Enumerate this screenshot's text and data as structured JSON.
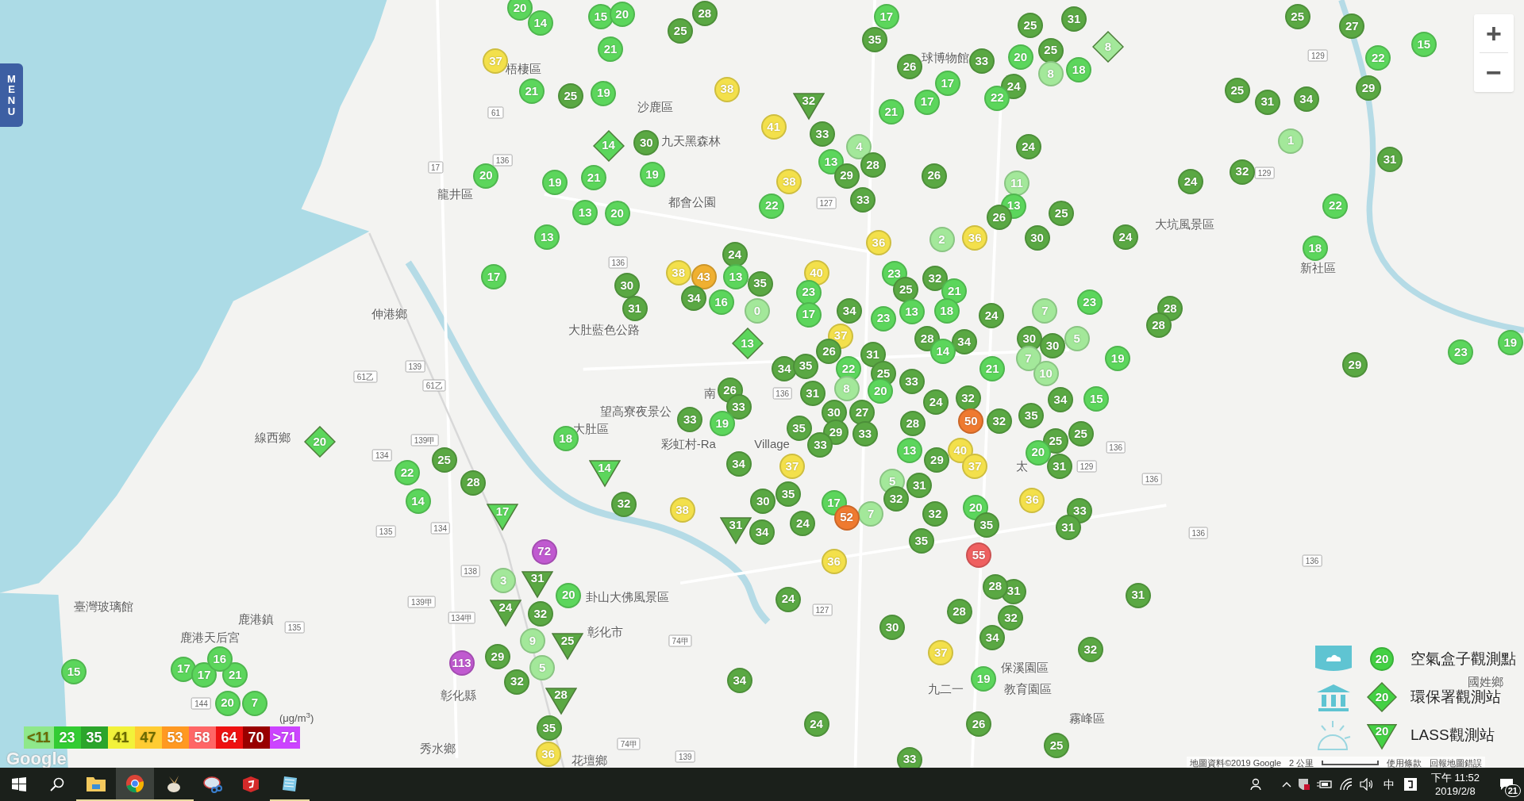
{
  "menu_button": "MENU",
  "zoom_controls": [
    "+",
    "−"
  ],
  "map_labels": [
    {
      "text": "梧棲區",
      "kind": "place"
    },
    {
      "text": "沙鹿區",
      "kind": "place"
    },
    {
      "text": "九天黑森林",
      "kind": "place"
    },
    {
      "text": "龍井區",
      "kind": "place"
    },
    {
      "text": "都會公園",
      "kind": "place"
    },
    {
      "text": "大肚藍色公路",
      "kind": "place"
    },
    {
      "text": "伸港鄉",
      "kind": "place"
    },
    {
      "text": "望高寮夜景公",
      "kind": "place"
    },
    {
      "text": "大肚區",
      "kind": "place"
    },
    {
      "text": "彩虹村-Ra",
      "kind": "place"
    },
    {
      "text": "Village",
      "kind": "place"
    },
    {
      "text": "南",
      "kind": "place"
    },
    {
      "text": "線西鄉",
      "kind": "place"
    },
    {
      "text": "鹿港鎮",
      "kind": "place"
    },
    {
      "text": "鹿港天后宮",
      "kind": "place"
    },
    {
      "text": "臺灣玻璃館",
      "kind": "place"
    },
    {
      "text": "卦山大佛風景區",
      "kind": "place"
    },
    {
      "text": "彰化市",
      "kind": "place"
    },
    {
      "text": "彰化縣",
      "kind": "place"
    },
    {
      "text": "秀水鄉",
      "kind": "place"
    },
    {
      "text": "花壇鄉",
      "kind": "place"
    },
    {
      "text": "大坑風景區",
      "kind": "place"
    },
    {
      "text": "新社區",
      "kind": "place"
    },
    {
      "text": "太",
      "kind": "place"
    },
    {
      "text": "國姓鄉",
      "kind": "place"
    },
    {
      "text": "霧峰區",
      "kind": "place"
    },
    {
      "text": "球博物館",
      "kind": "place"
    },
    {
      "text": "保溪園區",
      "kind": "place"
    },
    {
      "text": "九二一",
      "kind": "place"
    },
    {
      "text": "教育園區",
      "kind": "place"
    },
    {
      "text": "136",
      "kind": "road"
    },
    {
      "text": "17",
      "kind": "road"
    },
    {
      "text": "61",
      "kind": "road"
    },
    {
      "text": "136",
      "kind": "road"
    },
    {
      "text": "139",
      "kind": "road"
    },
    {
      "text": "61乙",
      "kind": "road"
    },
    {
      "text": "61乙",
      "kind": "road"
    },
    {
      "text": "139甲",
      "kind": "road"
    },
    {
      "text": "134",
      "kind": "road"
    },
    {
      "text": "134",
      "kind": "road"
    },
    {
      "text": "135",
      "kind": "road"
    },
    {
      "text": "138",
      "kind": "road"
    },
    {
      "text": "139甲",
      "kind": "road"
    },
    {
      "text": "134甲",
      "kind": "road"
    },
    {
      "text": "135",
      "kind": "road"
    },
    {
      "text": "144",
      "kind": "road"
    },
    {
      "text": "127",
      "kind": "road"
    },
    {
      "text": "127",
      "kind": "road"
    },
    {
      "text": "136",
      "kind": "road"
    },
    {
      "text": "129",
      "kind": "road"
    },
    {
      "text": "136",
      "kind": "road"
    },
    {
      "text": "136",
      "kind": "road"
    },
    {
      "text": "136",
      "kind": "road"
    },
    {
      "text": "129",
      "kind": "road"
    },
    {
      "text": "129",
      "kind": "road"
    },
    {
      "text": "74甲",
      "kind": "road"
    },
    {
      "text": "139",
      "kind": "road"
    },
    {
      "text": "74甲",
      "kind": "road"
    },
    {
      "text": "136",
      "kind": "road"
    }
  ],
  "markers": [
    {
      "value": "20",
      "kind": "box",
      "color": "#5cd65c"
    },
    {
      "value": "14",
      "kind": "box",
      "color": "#5cd65c"
    },
    {
      "value": "15",
      "kind": "box",
      "color": "#5cd65c"
    },
    {
      "value": "20",
      "kind": "box",
      "color": "#5cd65c"
    },
    {
      "value": "28",
      "kind": "box",
      "color": "#5aa843"
    },
    {
      "value": "25",
      "kind": "box",
      "color": "#5aa843"
    },
    {
      "value": "21",
      "kind": "box",
      "color": "#5cd65c"
    },
    {
      "value": "37",
      "kind": "box",
      "color": "#f3e04b"
    },
    {
      "value": "21",
      "kind": "box",
      "color": "#5cd65c"
    },
    {
      "value": "25",
      "kind": "box",
      "color": "#5aa843"
    },
    {
      "value": "19",
      "kind": "box",
      "color": "#5cd65c"
    },
    {
      "value": "38",
      "kind": "box",
      "color": "#f3e04b"
    },
    {
      "value": "32",
      "kind": "lass",
      "color": "#5aa843"
    },
    {
      "value": "41",
      "kind": "box",
      "color": "#f3e04b"
    },
    {
      "value": "33",
      "kind": "box",
      "color": "#5aa843"
    },
    {
      "value": "14",
      "kind": "epa",
      "color": "#5cd65c"
    },
    {
      "value": "30",
      "kind": "box",
      "color": "#5aa843"
    },
    {
      "value": "20",
      "kind": "box",
      "color": "#5cd65c"
    },
    {
      "value": "19",
      "kind": "box",
      "color": "#5cd65c"
    },
    {
      "value": "21",
      "kind": "box",
      "color": "#5cd65c"
    },
    {
      "value": "19",
      "kind": "box",
      "color": "#5cd65c"
    },
    {
      "value": "13",
      "kind": "box",
      "color": "#5cd65c"
    },
    {
      "value": "20",
      "kind": "box",
      "color": "#5cd65c"
    },
    {
      "value": "13",
      "kind": "box",
      "color": "#5cd65c"
    },
    {
      "value": "17",
      "kind": "box",
      "color": "#5cd65c"
    },
    {
      "value": "17",
      "kind": "box",
      "color": "#5cd65c"
    },
    {
      "value": "35",
      "kind": "box",
      "color": "#5aa843"
    },
    {
      "value": "26",
      "kind": "box",
      "color": "#5aa843"
    },
    {
      "value": "17",
      "kind": "box",
      "color": "#5cd65c"
    },
    {
      "value": "17",
      "kind": "box",
      "color": "#5cd65c"
    },
    {
      "value": "21",
      "kind": "box",
      "color": "#5cd65c"
    },
    {
      "value": "33",
      "kind": "box",
      "color": "#5aa843"
    },
    {
      "value": "20",
      "kind": "box",
      "color": "#5cd65c"
    },
    {
      "value": "25",
      "kind": "box",
      "color": "#5aa843"
    },
    {
      "value": "25",
      "kind": "box",
      "color": "#5aa843"
    },
    {
      "value": "31",
      "kind": "box",
      "color": "#5aa843"
    },
    {
      "value": "8",
      "kind": "epa",
      "color": "#a3e89a"
    },
    {
      "value": "18",
      "kind": "box",
      "color": "#5cd65c"
    },
    {
      "value": "8",
      "kind": "box",
      "color": "#a3e89a"
    },
    {
      "value": "24",
      "kind": "box",
      "color": "#5aa843"
    },
    {
      "value": "22",
      "kind": "box",
      "color": "#5cd65c"
    },
    {
      "value": "24",
      "kind": "box",
      "color": "#5aa843"
    },
    {
      "value": "11",
      "kind": "box",
      "color": "#a3e89a"
    },
    {
      "value": "13",
      "kind": "box",
      "color": "#5cd65c"
    },
    {
      "value": "26",
      "kind": "box",
      "color": "#5aa843"
    },
    {
      "value": "30",
      "kind": "box",
      "color": "#5aa843"
    },
    {
      "value": "25",
      "kind": "box",
      "color": "#5aa843"
    },
    {
      "value": "26",
      "kind": "box",
      "color": "#5aa843"
    },
    {
      "value": "4",
      "kind": "box",
      "color": "#a3e89a"
    },
    {
      "value": "13",
      "kind": "box",
      "color": "#5cd65c"
    },
    {
      "value": "29",
      "kind": "box",
      "color": "#5aa843"
    },
    {
      "value": "28",
      "kind": "box",
      "color": "#5aa843"
    },
    {
      "value": "33",
      "kind": "box",
      "color": "#5aa843"
    },
    {
      "value": "38",
      "kind": "box",
      "color": "#f3e04b"
    },
    {
      "value": "22",
      "kind": "box",
      "color": "#5cd65c"
    },
    {
      "value": "25",
      "kind": "box",
      "color": "#5aa843"
    },
    {
      "value": "27",
      "kind": "box",
      "color": "#5aa843"
    },
    {
      "value": "22",
      "kind": "box",
      "color": "#5cd65c"
    },
    {
      "value": "15",
      "kind": "box",
      "color": "#5cd65c"
    },
    {
      "value": "25",
      "kind": "box",
      "color": "#5aa843"
    },
    {
      "value": "31",
      "kind": "box",
      "color": "#5aa843"
    },
    {
      "value": "34",
      "kind": "box",
      "color": "#5aa843"
    },
    {
      "value": "29",
      "kind": "box",
      "color": "#5aa843"
    },
    {
      "value": "1",
      "kind": "box",
      "color": "#a3e89a"
    },
    {
      "value": "31",
      "kind": "box",
      "color": "#5aa843"
    },
    {
      "value": "32",
      "kind": "box",
      "color": "#5aa843"
    },
    {
      "value": "24",
      "kind": "box",
      "color": "#5aa843"
    },
    {
      "value": "22",
      "kind": "box",
      "color": "#5cd65c"
    },
    {
      "value": "24",
      "kind": "box",
      "color": "#5aa843"
    },
    {
      "value": "18",
      "kind": "box",
      "color": "#5cd65c"
    },
    {
      "value": "28",
      "kind": "box",
      "color": "#5aa843"
    },
    {
      "value": "28",
      "kind": "box",
      "color": "#5aa843"
    },
    {
      "value": "19",
      "kind": "box",
      "color": "#5cd65c"
    },
    {
      "value": "29",
      "kind": "box",
      "color": "#5aa843"
    },
    {
      "value": "23",
      "kind": "box",
      "color": "#5cd65c"
    },
    {
      "value": "19",
      "kind": "box",
      "color": "#5cd65c"
    },
    {
      "value": "31",
      "kind": "box",
      "color": "#5aa843"
    },
    {
      "value": "32",
      "kind": "box",
      "color": "#5aa843"
    },
    {
      "value": "25",
      "kind": "box",
      "color": "#5aa843"
    },
    {
      "value": "36",
      "kind": "box",
      "color": "#f3e04b"
    },
    {
      "value": "2",
      "kind": "box",
      "color": "#a3e89a"
    },
    {
      "value": "36",
      "kind": "box",
      "color": "#f3e04b"
    },
    {
      "value": "24",
      "kind": "box",
      "color": "#5aa843"
    },
    {
      "value": "38",
      "kind": "box",
      "color": "#f3e04b"
    },
    {
      "value": "43",
      "kind": "box",
      "color": "#f0b030"
    },
    {
      "value": "13",
      "kind": "box",
      "color": "#5cd65c"
    },
    {
      "value": "35",
      "kind": "box",
      "color": "#5aa843"
    },
    {
      "value": "40",
      "kind": "box",
      "color": "#f3e04b"
    },
    {
      "value": "30",
      "kind": "box",
      "color": "#5aa843"
    },
    {
      "value": "31",
      "kind": "box",
      "color": "#5aa843"
    },
    {
      "value": "34",
      "kind": "box",
      "color": "#5aa843"
    },
    {
      "value": "16",
      "kind": "box",
      "color": "#5cd65c"
    },
    {
      "value": "0",
      "kind": "box",
      "color": "#a3e89a"
    },
    {
      "value": "23",
      "kind": "box",
      "color": "#5cd65c"
    },
    {
      "value": "17",
      "kind": "box",
      "color": "#5cd65c"
    },
    {
      "value": "34",
      "kind": "box",
      "color": "#5aa843"
    },
    {
      "value": "37",
      "kind": "box",
      "color": "#f3e04b"
    },
    {
      "value": "23",
      "kind": "box",
      "color": "#5cd65c"
    },
    {
      "value": "25",
      "kind": "box",
      "color": "#5aa843"
    },
    {
      "value": "32",
      "kind": "box",
      "color": "#5aa843"
    },
    {
      "value": "21",
      "kind": "box",
      "color": "#5cd65c"
    },
    {
      "value": "13",
      "kind": "box",
      "color": "#5cd65c"
    },
    {
      "value": "18",
      "kind": "box",
      "color": "#5cd65c"
    },
    {
      "value": "23",
      "kind": "box",
      "color": "#5cd65c"
    },
    {
      "value": "28",
      "kind": "box",
      "color": "#5aa843"
    },
    {
      "value": "34",
      "kind": "box",
      "color": "#5aa843"
    },
    {
      "value": "24",
      "kind": "box",
      "color": "#5aa843"
    },
    {
      "value": "7",
      "kind": "box",
      "color": "#a3e89a"
    },
    {
      "value": "23",
      "kind": "box",
      "color": "#5cd65c"
    },
    {
      "value": "30",
      "kind": "box",
      "color": "#5aa843"
    },
    {
      "value": "30",
      "kind": "box",
      "color": "#5aa843"
    },
    {
      "value": "5",
      "kind": "box",
      "color": "#a3e89a"
    },
    {
      "value": "7",
      "kind": "box",
      "color": "#a3e89a"
    },
    {
      "value": "10",
      "kind": "box",
      "color": "#a3e89a"
    },
    {
      "value": "21",
      "kind": "box",
      "color": "#5cd65c"
    },
    {
      "value": "14",
      "kind": "box",
      "color": "#5cd65c"
    },
    {
      "value": "13",
      "kind": "epa",
      "color": "#5cd65c"
    },
    {
      "value": "26",
      "kind": "box",
      "color": "#5aa843"
    },
    {
      "value": "31",
      "kind": "box",
      "color": "#5aa843"
    },
    {
      "value": "34",
      "kind": "box",
      "color": "#5aa843"
    },
    {
      "value": "35",
      "kind": "box",
      "color": "#5aa843"
    },
    {
      "value": "22",
      "kind": "box",
      "color": "#5cd65c"
    },
    {
      "value": "25",
      "kind": "box",
      "color": "#5aa843"
    },
    {
      "value": "8",
      "kind": "box",
      "color": "#a3e89a"
    },
    {
      "value": "31",
      "kind": "box",
      "color": "#5aa843"
    },
    {
      "value": "20",
      "kind": "box",
      "color": "#5cd65c"
    },
    {
      "value": "33",
      "kind": "box",
      "color": "#5aa843"
    },
    {
      "value": "24",
      "kind": "box",
      "color": "#5aa843"
    },
    {
      "value": "32",
      "kind": "box",
      "color": "#5aa843"
    },
    {
      "value": "26",
      "kind": "box",
      "color": "#5aa843"
    },
    {
      "value": "33",
      "kind": "box",
      "color": "#5aa843"
    },
    {
      "value": "33",
      "kind": "box",
      "color": "#5aa843"
    },
    {
      "value": "35",
      "kind": "box",
      "color": "#5aa843"
    },
    {
      "value": "30",
      "kind": "box",
      "color": "#5aa843"
    },
    {
      "value": "27",
      "kind": "box",
      "color": "#5aa843"
    },
    {
      "value": "29",
      "kind": "box",
      "color": "#5aa843"
    },
    {
      "value": "33",
      "kind": "box",
      "color": "#5aa843"
    },
    {
      "value": "33",
      "kind": "box",
      "color": "#5aa843"
    },
    {
      "value": "28",
      "kind": "box",
      "color": "#5aa843"
    },
    {
      "value": "50",
      "kind": "box",
      "color": "#ef7a30"
    },
    {
      "value": "32",
      "kind": "box",
      "color": "#5aa843"
    },
    {
      "value": "35",
      "kind": "box",
      "color": "#5aa843"
    },
    {
      "value": "34",
      "kind": "box",
      "color": "#5aa843"
    },
    {
      "value": "15",
      "kind": "box",
      "color": "#5cd65c"
    },
    {
      "value": "25",
      "kind": "box",
      "color": "#5aa843"
    },
    {
      "value": "25",
      "kind": "box",
      "color": "#5aa843"
    },
    {
      "value": "20",
      "kind": "box",
      "color": "#5cd65c"
    },
    {
      "value": "31",
      "kind": "box",
      "color": "#5aa843"
    },
    {
      "value": "36",
      "kind": "box",
      "color": "#f3e04b"
    },
    {
      "value": "33",
      "kind": "box",
      "color": "#5aa843"
    },
    {
      "value": "31",
      "kind": "box",
      "color": "#5aa843"
    },
    {
      "value": "19",
      "kind": "box",
      "color": "#5cd65c"
    },
    {
      "value": "34",
      "kind": "box",
      "color": "#5aa843"
    },
    {
      "value": "18",
      "kind": "box",
      "color": "#5cd65c"
    },
    {
      "value": "14",
      "kind": "lass",
      "color": "#5cd65c"
    },
    {
      "value": "29",
      "kind": "box",
      "color": "#5aa843"
    },
    {
      "value": "13",
      "kind": "box",
      "color": "#5cd65c"
    },
    {
      "value": "40",
      "kind": "box",
      "color": "#f3e04b"
    },
    {
      "value": "37",
      "kind": "box",
      "color": "#f3e04b"
    },
    {
      "value": "31",
      "kind": "box",
      "color": "#5aa843"
    },
    {
      "value": "37",
      "kind": "box",
      "color": "#f3e04b"
    },
    {
      "value": "30",
      "kind": "box",
      "color": "#5aa843"
    },
    {
      "value": "35",
      "kind": "box",
      "color": "#5aa843"
    },
    {
      "value": "5",
      "kind": "box",
      "color": "#a3e89a"
    },
    {
      "value": "32",
      "kind": "box",
      "color": "#5aa843"
    },
    {
      "value": "7",
      "kind": "box",
      "color": "#a3e89a"
    },
    {
      "value": "17",
      "kind": "box",
      "color": "#5cd65c"
    },
    {
      "value": "52",
      "kind": "box",
      "color": "#ef7a30"
    },
    {
      "value": "24",
      "kind": "box",
      "color": "#5aa843"
    },
    {
      "value": "34",
      "kind": "box",
      "color": "#5aa843"
    },
    {
      "value": "31",
      "kind": "lass",
      "color": "#5aa843"
    },
    {
      "value": "38",
      "kind": "box",
      "color": "#f3e04b"
    },
    {
      "value": "32",
      "kind": "box",
      "color": "#5aa843"
    },
    {
      "value": "20",
      "kind": "box",
      "color": "#5cd65c"
    },
    {
      "value": "35",
      "kind": "box",
      "color": "#5aa843"
    },
    {
      "value": "35",
      "kind": "box",
      "color": "#5aa843"
    },
    {
      "value": "55",
      "kind": "box",
      "color": "#ef6060"
    },
    {
      "value": "31",
      "kind": "box",
      "color": "#5aa843"
    },
    {
      "value": "28",
      "kind": "box",
      "color": "#5aa843"
    },
    {
      "value": "32",
      "kind": "box",
      "color": "#5aa843"
    },
    {
      "value": "34",
      "kind": "box",
      "color": "#5aa843"
    },
    {
      "value": "28",
      "kind": "box",
      "color": "#5aa843"
    },
    {
      "value": "30",
      "kind": "box",
      "color": "#5aa843"
    },
    {
      "value": "37",
      "kind": "box",
      "color": "#f3e04b"
    },
    {
      "value": "19",
      "kind": "box",
      "color": "#5cd65c"
    },
    {
      "value": "26",
      "kind": "box",
      "color": "#5aa843"
    },
    {
      "value": "33",
      "kind": "box",
      "color": "#5aa843"
    },
    {
      "value": "24",
      "kind": "box",
      "color": "#5aa843"
    },
    {
      "value": "34",
      "kind": "box",
      "color": "#5aa843"
    },
    {
      "value": "24",
      "kind": "box",
      "color": "#5aa843"
    },
    {
      "value": "36",
      "kind": "box",
      "color": "#f3e04b"
    },
    {
      "value": "32",
      "kind": "box",
      "color": "#5aa843"
    },
    {
      "value": "17",
      "kind": "lass",
      "color": "#5cd65c"
    },
    {
      "value": "25",
      "kind": "box",
      "color": "#5aa843"
    },
    {
      "value": "28",
      "kind": "box",
      "color": "#5aa843"
    },
    {
      "value": "22",
      "kind": "box",
      "color": "#5cd65c"
    },
    {
      "value": "14",
      "kind": "box",
      "color": "#5cd65c"
    },
    {
      "value": "20",
      "kind": "epa",
      "color": "#5cd65c"
    },
    {
      "value": "72",
      "kind": "box",
      "color": "#c05ad0"
    },
    {
      "value": "31",
      "kind": "lass",
      "color": "#5aa843"
    },
    {
      "value": "3",
      "kind": "box",
      "color": "#a3e89a"
    },
    {
      "value": "32",
      "kind": "box",
      "color": "#5aa843"
    },
    {
      "value": "20",
      "kind": "box",
      "color": "#5cd65c"
    },
    {
      "value": "24",
      "kind": "lass",
      "color": "#5aa843"
    },
    {
      "value": "9",
      "kind": "box",
      "color": "#a3e89a"
    },
    {
      "value": "25",
      "kind": "lass",
      "color": "#5aa843"
    },
    {
      "value": "5",
      "kind": "box",
      "color": "#a3e89a"
    },
    {
      "value": "29",
      "kind": "box",
      "color": "#5aa843"
    },
    {
      "value": "32",
      "kind": "box",
      "color": "#5aa843"
    },
    {
      "value": "113",
      "kind": "box",
      "color": "#c05ad0"
    },
    {
      "value": "35",
      "kind": "box",
      "color": "#5aa843"
    },
    {
      "value": "28",
      "kind": "lass",
      "color": "#5aa843"
    },
    {
      "value": "36",
      "kind": "box",
      "color": "#f3e04b"
    },
    {
      "value": "15",
      "kind": "box",
      "color": "#5cd65c"
    },
    {
      "value": "17",
      "kind": "box",
      "color": "#5cd65c"
    },
    {
      "value": "17",
      "kind": "box",
      "color": "#5cd65c"
    },
    {
      "value": "21",
      "kind": "box",
      "color": "#5cd65c"
    },
    {
      "value": "16",
      "kind": "box",
      "color": "#5cd65c"
    },
    {
      "value": "20",
      "kind": "box",
      "color": "#5cd65c"
    },
    {
      "value": "7",
      "kind": "box",
      "color": "#5cd65c"
    }
  ],
  "pm_legend": {
    "unit": "(μg/m$^{3}$)",
    "items": [
      {
        "label": "<11",
        "color": "#8fe88a"
      },
      {
        "label": "23",
        "color": "#33cc33"
      },
      {
        "label": "35",
        "color": "#2ba52b"
      },
      {
        "label": "41",
        "color": "#f2f23a"
      },
      {
        "label": "47",
        "color": "#ffcc33"
      },
      {
        "label": "53",
        "color": "#ff9922"
      },
      {
        "label": "58",
        "color": "#ff6666"
      },
      {
        "label": "64",
        "color": "#ee1111"
      },
      {
        "label": "70",
        "color": "#990000"
      },
      {
        "label": ">71",
        "color": "#cc44ff"
      }
    ]
  },
  "station_legend": [
    {
      "kind": "box",
      "sample": "20",
      "label": "空氣盒子觀測點"
    },
    {
      "kind": "epa",
      "sample": "20",
      "label": "環保署觀測站"
    },
    {
      "kind": "lass",
      "sample": "20",
      "label": "LASS觀測站"
    }
  ],
  "map_footer": {
    "logo": "Google",
    "attribution": "地圖資料©2019 Google",
    "scale": "2 公里",
    "terms": "使用條款",
    "report": "回報地圖錯誤"
  },
  "taskbar": {
    "input_method": "中",
    "time": "下午 11:52",
    "date": "2019/2/8",
    "notifications": "21"
  }
}
